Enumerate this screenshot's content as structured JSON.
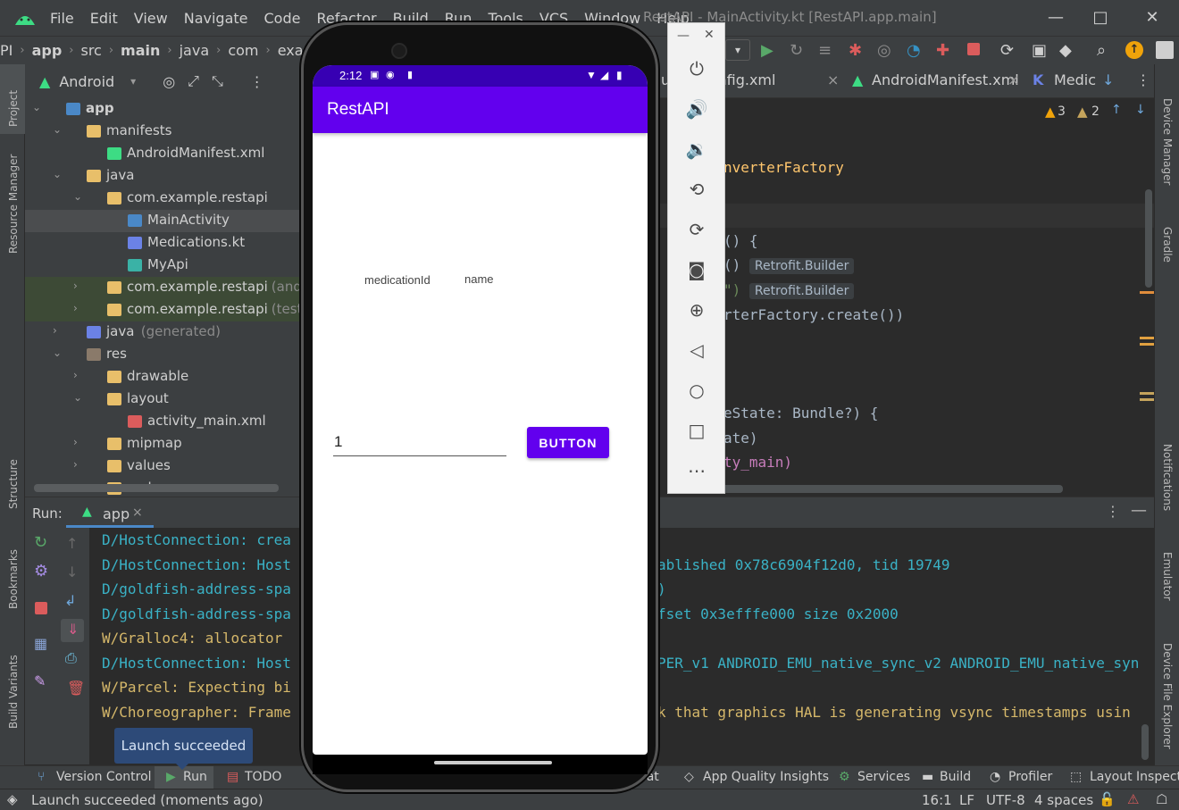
{
  "window": {
    "title": "RestAPI - MainActivity.kt [RestAPI.app.main]",
    "menu": [
      "File",
      "Edit",
      "View",
      "Navigate",
      "Code",
      "Refactor",
      "Build",
      "Run",
      "Tools",
      "VCS",
      "Window",
      "Help"
    ]
  },
  "breadcrumb": [
    "PI",
    "app",
    "src",
    "main",
    "java",
    "com",
    "example"
  ],
  "project_panel": {
    "view_label": "Android",
    "tree": [
      {
        "label": "app",
        "hint": "",
        "depth": 0,
        "arrow": "v",
        "icon": "folder-module-icon"
      },
      {
        "label": "manifests",
        "hint": "",
        "depth": 1,
        "arrow": "v",
        "icon": "folder-icon"
      },
      {
        "label": "AndroidManifest.xml",
        "hint": "",
        "depth": 2,
        "arrow": "",
        "icon": "android-icon"
      },
      {
        "label": "java",
        "hint": "",
        "depth": 1,
        "arrow": "v",
        "icon": "folder-icon"
      },
      {
        "label": "com.example.restapi",
        "hint": "",
        "depth": 2,
        "arrow": "v",
        "icon": "package-icon"
      },
      {
        "label": "MainActivity",
        "hint": "",
        "depth": 3,
        "arrow": "",
        "icon": "kotlin-class-icon"
      },
      {
        "label": "Medications.kt",
        "hint": "",
        "depth": 3,
        "arrow": "",
        "icon": "kotlin-file-icon"
      },
      {
        "label": "MyApi",
        "hint": "",
        "depth": 3,
        "arrow": "",
        "icon": "interface-icon"
      },
      {
        "label": "com.example.restapi",
        "hint": "(androidTest)",
        "depth": 2,
        "arrow": ">",
        "icon": "package-icon"
      },
      {
        "label": "com.example.restapi",
        "hint": "(test)",
        "depth": 2,
        "arrow": ">",
        "icon": "package-icon"
      },
      {
        "label": "java",
        "hint": "(generated)",
        "depth": 1,
        "arrow": ">",
        "icon": "generated-folder-icon"
      },
      {
        "label": "res",
        "hint": "",
        "depth": 1,
        "arrow": "v",
        "icon": "res-folder-icon"
      },
      {
        "label": "drawable",
        "hint": "",
        "depth": 2,
        "arrow": ">",
        "icon": "folder-icon"
      },
      {
        "label": "layout",
        "hint": "",
        "depth": 2,
        "arrow": "v",
        "icon": "folder-icon"
      },
      {
        "label": "activity_main.xml",
        "hint": "",
        "depth": 3,
        "arrow": "",
        "icon": "layout-file-icon"
      },
      {
        "label": "mipmap",
        "hint": "",
        "depth": 2,
        "arrow": ">",
        "icon": "folder-icon"
      },
      {
        "label": "values",
        "hint": "",
        "depth": 2,
        "arrow": ">",
        "icon": "folder-icon"
      },
      {
        "label": "xml",
        "hint": "",
        "depth": 2,
        "arrow": "v",
        "icon": "folder-icon"
      }
    ]
  },
  "editor": {
    "tabs": [
      "urity_config.xml",
      "AndroidManifest.xml",
      "Medic"
    ],
    "warnings": "3",
    "weak_warnings": "2",
    "code": [
      {
        "text": "nverterFactory",
        "hint": ""
      },
      {
        "text": "() {",
        "hint": ""
      },
      {
        "text": "()",
        "hint": "Retrofit.Builder"
      },
      {
        "text": "\")",
        "hint": "Retrofit.Builder"
      },
      {
        "text": "rterFactory.create())",
        "hint": ""
      },
      {
        "text": "eState: Bundle?) {",
        "hint": ""
      },
      {
        "text": "ate)",
        "hint": ""
      },
      {
        "text": "ty_main)",
        "hint": ""
      }
    ]
  },
  "run_panel": {
    "label": "Run:",
    "tab": "app",
    "logs_left": [
      {
        "level": "D",
        "text": "D/HostConnection: crea"
      },
      {
        "level": "D",
        "text": "D/HostConnection: Host"
      },
      {
        "level": "D",
        "text": "D/goldfish-address-spa"
      },
      {
        "level": "D",
        "text": "D/goldfish-address-spa"
      },
      {
        "level": "W",
        "text": "W/Gralloc4: allocator "
      },
      {
        "level": "D",
        "text": "D/HostConnection: Host"
      },
      {
        "level": "W",
        "text": "W/Parcel: Expecting bi"
      },
      {
        "level": "W",
        "text": "W/Choreographer: Frame"
      }
    ],
    "logs_right": [
      {
        "level": "D",
        "text": ""
      },
      {
        "level": "D",
        "text": "ablished 0x78c6904f12d0, tid 19749"
      },
      {
        "level": "D",
        "text": ")"
      },
      {
        "level": "D",
        "text": "fset 0x3efffe000 size 0x2000"
      },
      {
        "level": "W",
        "text": ""
      },
      {
        "level": "D",
        "text": "PER_v1 ANDROID_EMU_native_sync_v2 ANDROID_EMU_native_syn"
      },
      {
        "level": "W",
        "text": ""
      },
      {
        "level": "W",
        "text": "k that graphics HAL is generating vsync timestamps usin"
      }
    ]
  },
  "tooltip": "Launch succeeded",
  "bottom_tools": [
    "Version Control",
    "Run",
    "TODO",
    "cat",
    "App Quality Insights",
    "Services",
    "Build",
    "Profiler",
    "Layout Inspector"
  ],
  "status_bar": {
    "message": "Launch succeeded (moments ago)",
    "position": "16:1",
    "line_sep": "LF",
    "encoding": "UTF-8",
    "indent": "4 spaces"
  },
  "left_stripe": [
    "Project",
    "Resource Manager",
    "Structure",
    "Bookmarks",
    "Build Variants"
  ],
  "right_stripe": [
    "Device Manager",
    "Gradle",
    "Notifications",
    "Emulator",
    "Device File Explorer"
  ],
  "phone": {
    "time": "2:12",
    "app_title": "RestAPI",
    "label_medication_id": "medicationId",
    "label_name": "name",
    "input_value": "1",
    "button_label": "BUTTON"
  },
  "colors": {
    "app_bar": "#6200ee",
    "status_bar": "#3700b3",
    "log_debug": "#3ab2c6",
    "log_warning": "#d6b86a"
  }
}
